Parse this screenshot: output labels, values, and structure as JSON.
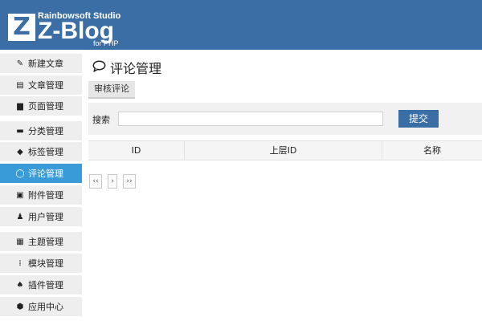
{
  "header": {
    "logo_letter": "Z",
    "studio": "Rainbowsoft Studio",
    "brand": "Z-Blog",
    "sub": "for PHP",
    "color": "#3a6ea5"
  },
  "sidebar": {
    "active_color": "#3a9bd9",
    "items": [
      {
        "label": "新建文章",
        "icon": "pencil-icon",
        "glyph": "✎"
      },
      {
        "label": "文章管理",
        "icon": "article-icon",
        "glyph": "▤"
      },
      {
        "label": "页面管理",
        "icon": "page-icon",
        "glyph": "▆"
      },
      {
        "label": "分类管理",
        "icon": "folder-icon",
        "glyph": "▬"
      },
      {
        "label": "标签管理",
        "icon": "tag-icon",
        "glyph": "◆"
      },
      {
        "label": "评论管理",
        "icon": "comment-icon",
        "glyph": "◯"
      },
      {
        "label": "附件管理",
        "icon": "attachment-icon",
        "glyph": "▣"
      },
      {
        "label": "用户管理",
        "icon": "user-icon",
        "glyph": "♟"
      },
      {
        "label": "主题管理",
        "icon": "theme-icon",
        "glyph": "▦"
      },
      {
        "label": "模块管理",
        "icon": "module-icon",
        "glyph": "⁞"
      },
      {
        "label": "插件管理",
        "icon": "plugin-icon",
        "glyph": "♠"
      },
      {
        "label": "应用中心",
        "icon": "app-center-icon",
        "glyph": "⬢"
      }
    ]
  },
  "main": {
    "title": "评论管理",
    "title_icon": "comment-icon",
    "subtab": "审核评论",
    "search_label": "搜索",
    "search_value": "",
    "submit_label": "提交",
    "columns": [
      "ID",
      "上层ID",
      "名称"
    ],
    "pager": [
      "‹‹",
      "›",
      "››"
    ]
  }
}
